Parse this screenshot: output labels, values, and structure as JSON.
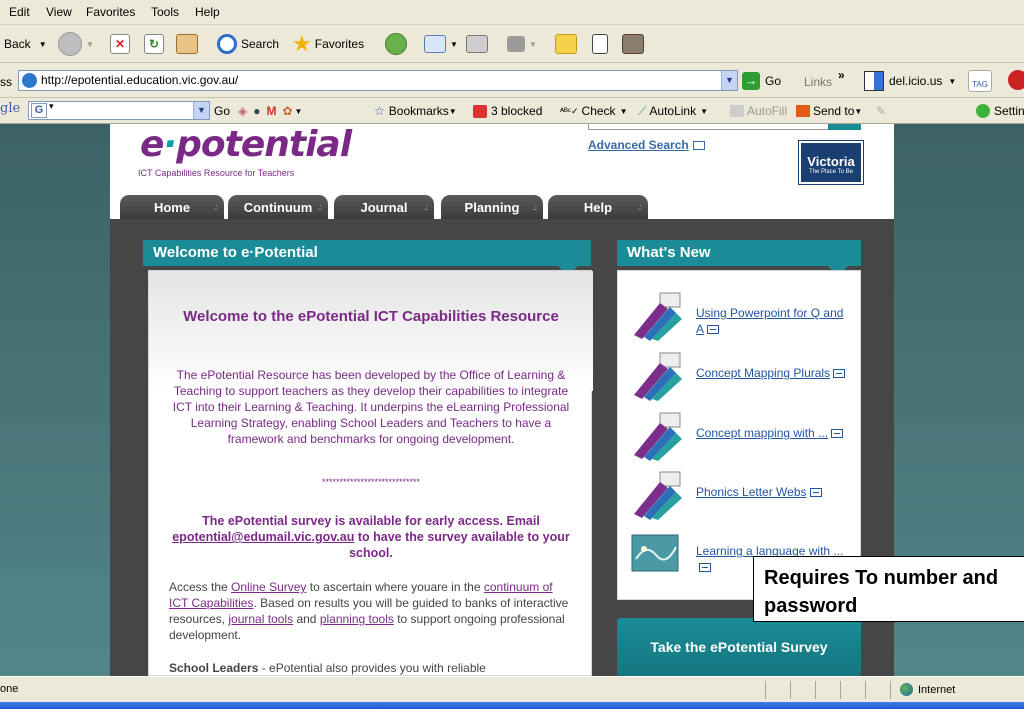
{
  "menubar": {
    "items": [
      "Edit",
      "View",
      "Favorites",
      "Tools",
      "Help"
    ]
  },
  "toolbar": {
    "back": "Back",
    "search": "Search",
    "favorites": "Favorites"
  },
  "address": {
    "label": "ss",
    "url": "http://epotential.education.vic.gov.au/",
    "go": "Go",
    "links": "Links",
    "delicious": "del.icio.us",
    "tag": "TAG"
  },
  "googlebar": {
    "brand": "gle",
    "g": "G",
    "go": "Go",
    "bookmarks": "Bookmarks",
    "blocked": "3 blocked",
    "check": "Check",
    "autolink": "AutoLink",
    "autofill": "AutoFill",
    "sendto": "Send to",
    "settings": "Settin"
  },
  "site": {
    "logo_e": "e",
    "logo_dot": "·",
    "logo_word": "potential",
    "tagline": "ICT Capabilities Resource for Teachers",
    "advanced_search": "Advanced Search",
    "victoria": "Victoria",
    "victoria_sub": "The Place To Be",
    "tabs": [
      "Home",
      "Continuum",
      "Journal",
      "Planning",
      "Help"
    ]
  },
  "welcome": {
    "panel_title": "Welcome to e·Potential",
    "heading": "Welcome to the ePotential ICT Capabilities Resource",
    "intro": "The ePotential Resource has been developed by the Office of Learning & Teaching to support teachers as they develop their capabilities to integrate ICT into their Learning & Teaching.   It underpins the eLearning Professional Learning Strategy, enabling School Leaders and Teachers to have a framework and benchmarks for ongoing development.",
    "stars": "****************************",
    "survey_1": "The ePotential survey is available for early access.   Email",
    "survey_email": "epotential@edumail.vic.gov.au",
    "survey_2": "to have the survey available to your school.",
    "access_1": "Access the",
    "access_link1": "Online Survey",
    "access_2": "to ascertain where youare in the",
    "access_link2": "continuum of ICT Capabilities",
    "access_3": ".  Based on results you will be guided to banks of interactive resources,",
    "access_link3": "journal tools",
    "access_4": "and",
    "access_link4": "planning tools",
    "access_5": "to support ongoing professional development.",
    "leaders_bold": "School Leaders",
    "leaders_rest": "- ePotential also provides you with reliable"
  },
  "whats_new": {
    "panel_title": "What's New",
    "items": [
      {
        "label": "Using Powerpoint for Q and A"
      },
      {
        "label": "Concept Mapping Plurals"
      },
      {
        "label": "Concept mapping with ..."
      },
      {
        "label": "Phonics Letter Webs"
      },
      {
        "label": "Learning a language with ..."
      }
    ]
  },
  "survey_button": "Take the ePotential Survey",
  "callout": "Requires To number and password",
  "status": {
    "text": "one",
    "zone": "Internet"
  },
  "colors": {
    "teal": "#1b8c97",
    "purple": "#7a2a86",
    "link": "#2255a4",
    "dark": "#464646"
  }
}
